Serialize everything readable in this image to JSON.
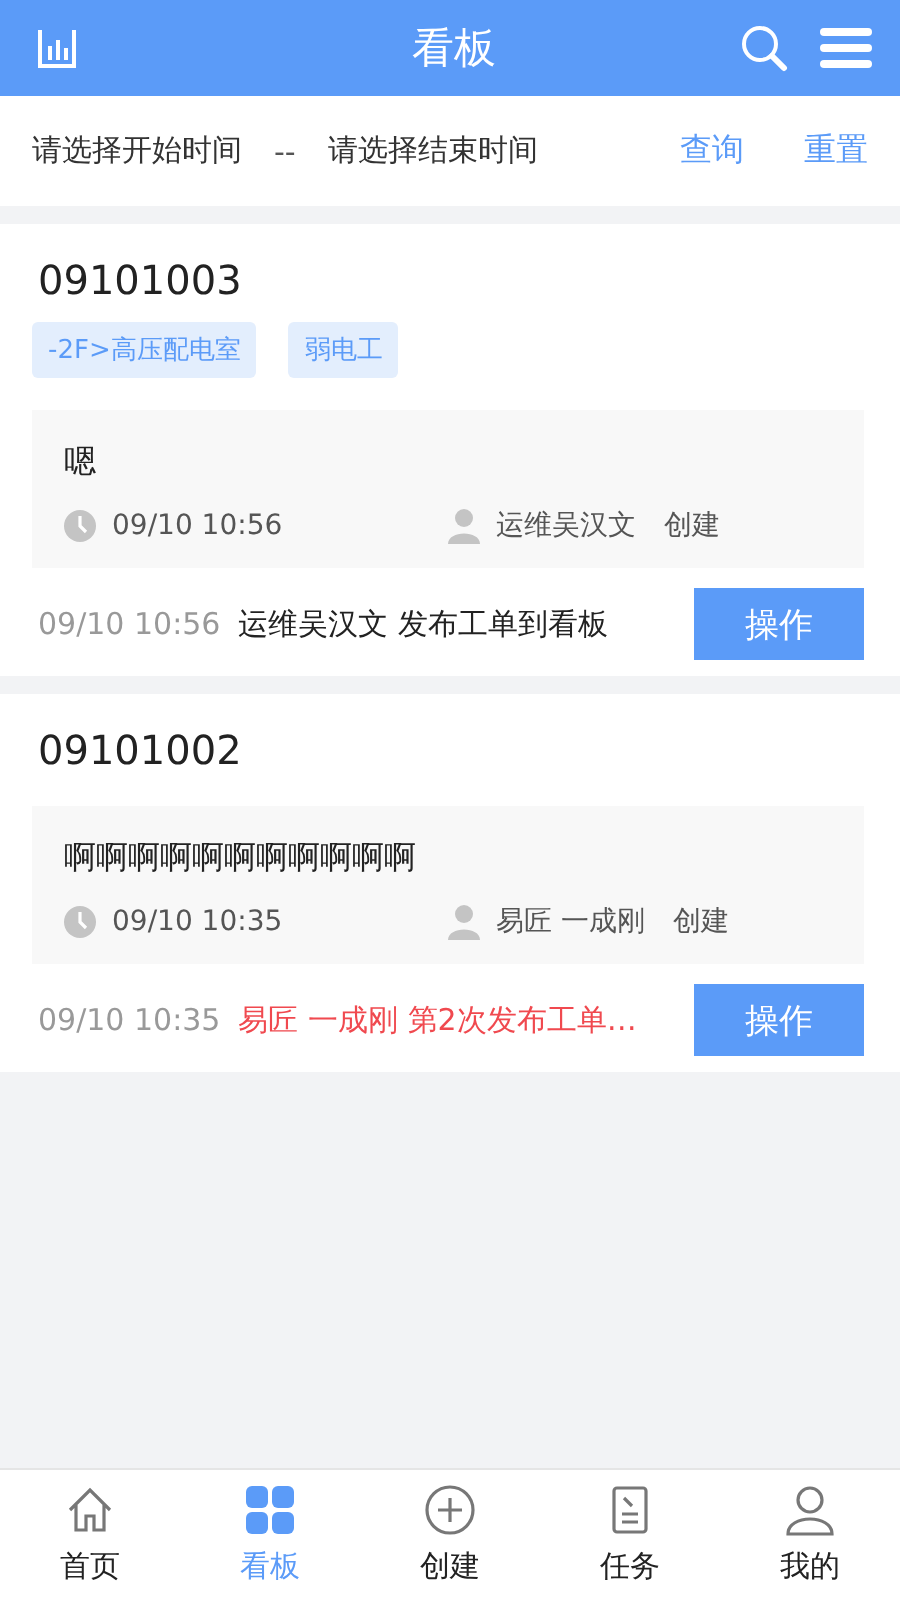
{
  "header": {
    "title": "看板"
  },
  "filter": {
    "start_placeholder": "请选择开始时间",
    "separator": "--",
    "end_placeholder": "请选择结束时间",
    "query_button": "查询",
    "reset_button": "重置"
  },
  "cards": [
    {
      "number": "09101003",
      "tags": [
        "-2F>高压配电室",
        "弱电工"
      ],
      "note": "嗯",
      "time": "09/10 10:56",
      "creator": "运维吴汉文",
      "action": "创建",
      "log_time": "09/10 10:56",
      "log_text": "运维吴汉文 发布工单到看板",
      "log_alert": false,
      "button": "操作"
    },
    {
      "number": "09101002",
      "note": "啊啊啊啊啊啊啊啊啊啊啊",
      "time": "09/10 10:35",
      "creator": "易匠 一成刚",
      "action": "创建",
      "log_time": "09/10 10:35",
      "log_text": "易匠 一成刚 第2次发布工单…",
      "log_alert": true,
      "button": "操作"
    }
  ],
  "tabs": [
    {
      "label": "首页",
      "selected": false
    },
    {
      "label": "看板",
      "selected": true
    },
    {
      "label": "创建",
      "selected": false
    },
    {
      "label": "任务",
      "selected": false
    },
    {
      "label": "我的",
      "selected": false
    }
  ]
}
